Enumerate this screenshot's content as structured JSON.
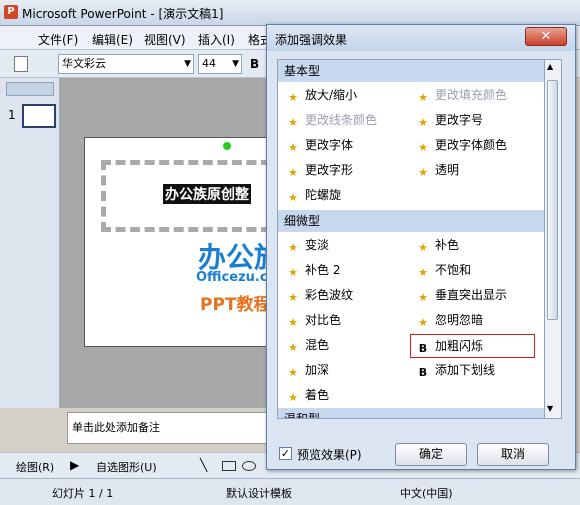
{
  "window": {
    "title": "Microsoft PowerPoint - [演示文稿1]"
  },
  "menu": [
    "文件(F)",
    "编辑(E)",
    "视图(V)",
    "插入(I)",
    "格式"
  ],
  "toolbar": {
    "font": "华文彩云",
    "size": "44",
    "bold": "B"
  },
  "slide": {
    "number": "1",
    "text": "办公族原创整"
  },
  "notes": {
    "placeholder": "单击此处添加备注"
  },
  "drawbar": {
    "draw": "绘图(R)",
    "autoshape": "自选图形(U)"
  },
  "status": {
    "slide": "幻灯片 1 / 1",
    "template": "默认设计模板",
    "lang": "中文(中国)"
  },
  "watermark": {
    "line1": "办公族",
    "line2": "Officezu.com",
    "line3": "PPT教程"
  },
  "dialog": {
    "title": "添加强调效果",
    "categories": [
      "基本型",
      "细微型",
      "温和型"
    ],
    "basic": [
      {
        "label": "放大/缩小",
        "disabled": false
      },
      {
        "label": "更改填充颜色",
        "disabled": true
      },
      {
        "label": "更改线条颜色",
        "disabled": true
      },
      {
        "label": "更改字号",
        "disabled": false
      },
      {
        "label": "更改字体",
        "disabled": false
      },
      {
        "label": "更改字体颜色",
        "disabled": false
      },
      {
        "label": "更改字形",
        "disabled": false
      },
      {
        "label": "透明",
        "disabled": false
      },
      {
        "label": "陀螺旋",
        "disabled": false
      }
    ],
    "subtle": [
      {
        "label": "变淡"
      },
      {
        "label": "补色"
      },
      {
        "label": "补色 2"
      },
      {
        "label": "不饱和"
      },
      {
        "label": "彩色波纹"
      },
      {
        "label": "垂直突出显示"
      },
      {
        "label": "对比色"
      },
      {
        "label": "忽明忽暗"
      },
      {
        "label": "混色"
      },
      {
        "label": "加粗闪烁"
      },
      {
        "label": "加深"
      },
      {
        "label": "添加下划线"
      },
      {
        "label": "着色"
      }
    ],
    "preview_label": "预览效果(P)",
    "ok": "确定",
    "cancel": "取消"
  }
}
